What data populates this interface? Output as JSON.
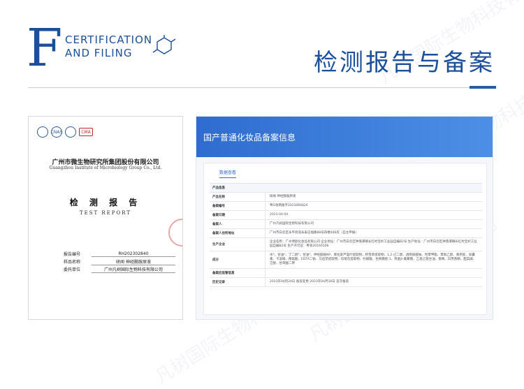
{
  "header": {
    "letter": "F",
    "line1": "CERTIFICATION",
    "line2": "AND FILING",
    "title": "检测报告与备案"
  },
  "watermark": "凡树国际生物科技有限公司",
  "report": {
    "logos": [
      "ISO/CNAS",
      "CNAS",
      "CMA"
    ],
    "org": "广州市微生物研究所集团股份有限公司",
    "org_en": "Guangzhou Institute of Microbiology Group Co., Ltd.",
    "title": "检 测 报 告",
    "title_en": "TEST REPORT",
    "fields": [
      {
        "label": "报告编号",
        "value": "RH202302840"
      },
      {
        "label": "样品名称",
        "value": "研闻 神经酰胺原液"
      },
      {
        "label": "委托单位",
        "value": "广州凡树国际生物科技有限公司"
      }
    ]
  },
  "registry": {
    "header_title": "国产普通化妆品备案信息",
    "tab": "数据查看",
    "rows": [
      {
        "label": "产品信息",
        "value": "",
        "head": true
      },
      {
        "label": "产品名称",
        "value": "研闻 神经酰胺原液"
      },
      {
        "label": "备案编号",
        "value": "粤G妆网备字2023066824"
      },
      {
        "label": "备案日期",
        "value": "2023-04-04"
      },
      {
        "label": "备案人",
        "value": "广州凡树国际生物科技有限公司"
      },
      {
        "label": "备案人住所地址",
        "value": "广州市白云区永平街道永泰庄福路88号四楼406房（自主申报）"
      },
      {
        "label": "生产企业",
        "value": "企业名称：广州博颜化妆品有限公司 企业地址：广州市白云区钟落潭镇长红村宝岭工业园自编B2号 生产地址：广州市白云区钟落潭镇长红村宝岭工业园自编B2号 生产许可证：粤妆20160108"
      },
      {
        "label": "成分",
        "value": "水*、甘油*、丁二醇*、甘油*、神经酰胺NP、库拉索芦荟叶提取物、积雪草提取物、1,2-己二醇、透明质酸钠、羟苯甲酯、苯氧乙醇、黄原胶、尿囊素、卡波姆、精氨酸、EDTA二钠、马齿苋提取物、母菊花提取物、柠檬酸、生物糖胶-1、燕麦β-葡聚糖、乙基己基甘油、香精、日用香精、甜菜碱、泛醇、甘草酸二钾"
      },
      {
        "label": "备案后监管信息",
        "value": ""
      },
      {
        "label": "历史记录",
        "value": "2023年04月24日 备案变更  2023年04月18日 首次备案"
      }
    ]
  },
  "colors": {
    "brand": "#1c4f9a",
    "accent": "#2e6ccf"
  }
}
